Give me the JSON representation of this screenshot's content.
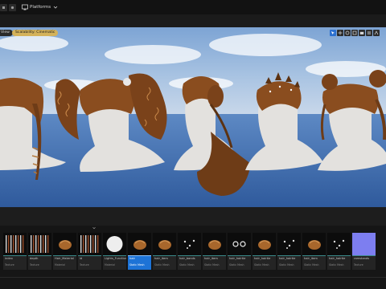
{
  "titlebar": {
    "platforms_label": "Platforms"
  },
  "viewport": {
    "view_mode_label": "View",
    "scalability_label": "Scalability: Cinematic",
    "toolbar_icons": [
      "select-icon",
      "move-icon",
      "rotate-icon",
      "scale-icon",
      "camera-icon",
      "grid-icon",
      "snap-icon"
    ]
  },
  "content_browser": {
    "assets": [
      {
        "name": "index",
        "type": "Texture",
        "thumb": "strands"
      },
      {
        "name": "depth",
        "type": "Texture",
        "thumb": "strands"
      },
      {
        "name": "Hair_Material",
        "type": "Material",
        "thumb": "hairball"
      },
      {
        "name": "id",
        "type": "Texture",
        "thumb": "strands"
      },
      {
        "name": "Lights_Functions",
        "type": "Material",
        "thumb": "sphere"
      },
      {
        "name": "hair",
        "type": "Static Mesh",
        "thumb": "hairball",
        "selected": true
      },
      {
        "name": "hair_item",
        "type": "Static Mesh",
        "thumb": "hairball"
      },
      {
        "name": "hair_bands",
        "type": "Static Mesh",
        "thumb": "dots"
      },
      {
        "name": "hair_item",
        "type": "Static Mesh",
        "thumb": "hairball"
      },
      {
        "name": "hair_hairtie",
        "type": "Static Mesh",
        "thumb": "rings"
      },
      {
        "name": "hair_hairtie",
        "type": "Static Mesh",
        "thumb": "hairball"
      },
      {
        "name": "hair_hairtie",
        "type": "Static Mesh",
        "thumb": "dots"
      },
      {
        "name": "hair_item",
        "type": "Static Mesh",
        "thumb": "hairball"
      },
      {
        "name": "hair_hairtie",
        "type": "Static Mesh",
        "thumb": "dots"
      },
      {
        "name": "ramstands",
        "type": "Texture",
        "thumb": "purple"
      }
    ]
  },
  "colors": {
    "accent": "#1d73d6",
    "scalability_pill": "#d4b25a",
    "sky": "#7aa0cf",
    "ground": "#3d6bb0",
    "mannequin": "#e3e1de",
    "hair": "#8a4d1f"
  }
}
